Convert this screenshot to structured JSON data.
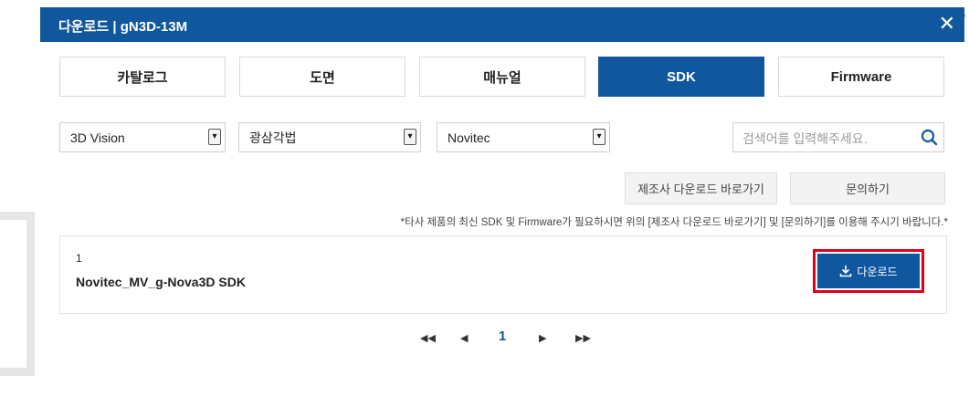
{
  "dialog": {
    "title": "다운로드 | gN3D-13M",
    "close_label": "✕"
  },
  "tabs": [
    {
      "label": "카탈로그",
      "active": false
    },
    {
      "label": "도면",
      "active": false
    },
    {
      "label": "매뉴얼",
      "active": false
    },
    {
      "label": "SDK",
      "active": true
    },
    {
      "label": "Firmware",
      "active": false
    }
  ],
  "filters": {
    "category": {
      "value": "3D Vision"
    },
    "subcategory": {
      "value": "광삼각법"
    },
    "maker": {
      "value": "Novitec"
    },
    "caret_glyph": "▾"
  },
  "search": {
    "placeholder": "검색어를 입력해주세요.",
    "icon": "search-icon"
  },
  "actions": {
    "maker_download_label": "제조사 다운로드 바로가기",
    "inquiry_label": "문의하기"
  },
  "notice": "*타사 제품의 최신 SDK 및 Firmware가 필요하시면 위의 [제조사 다운로드 바로가기] 및 [문의하기]를 이용해 주시기 바랍니다.*",
  "results": [
    {
      "number": "1",
      "name": "Novitec_MV_g-Nova3D SDK",
      "download_label": "다운로드"
    }
  ],
  "pagination": {
    "first": "◀◀",
    "prev": "◀",
    "current": "1",
    "next": "▶",
    "last": "▶▶"
  },
  "colors": {
    "primary": "#11579e",
    "highlight": "#e1001a"
  }
}
